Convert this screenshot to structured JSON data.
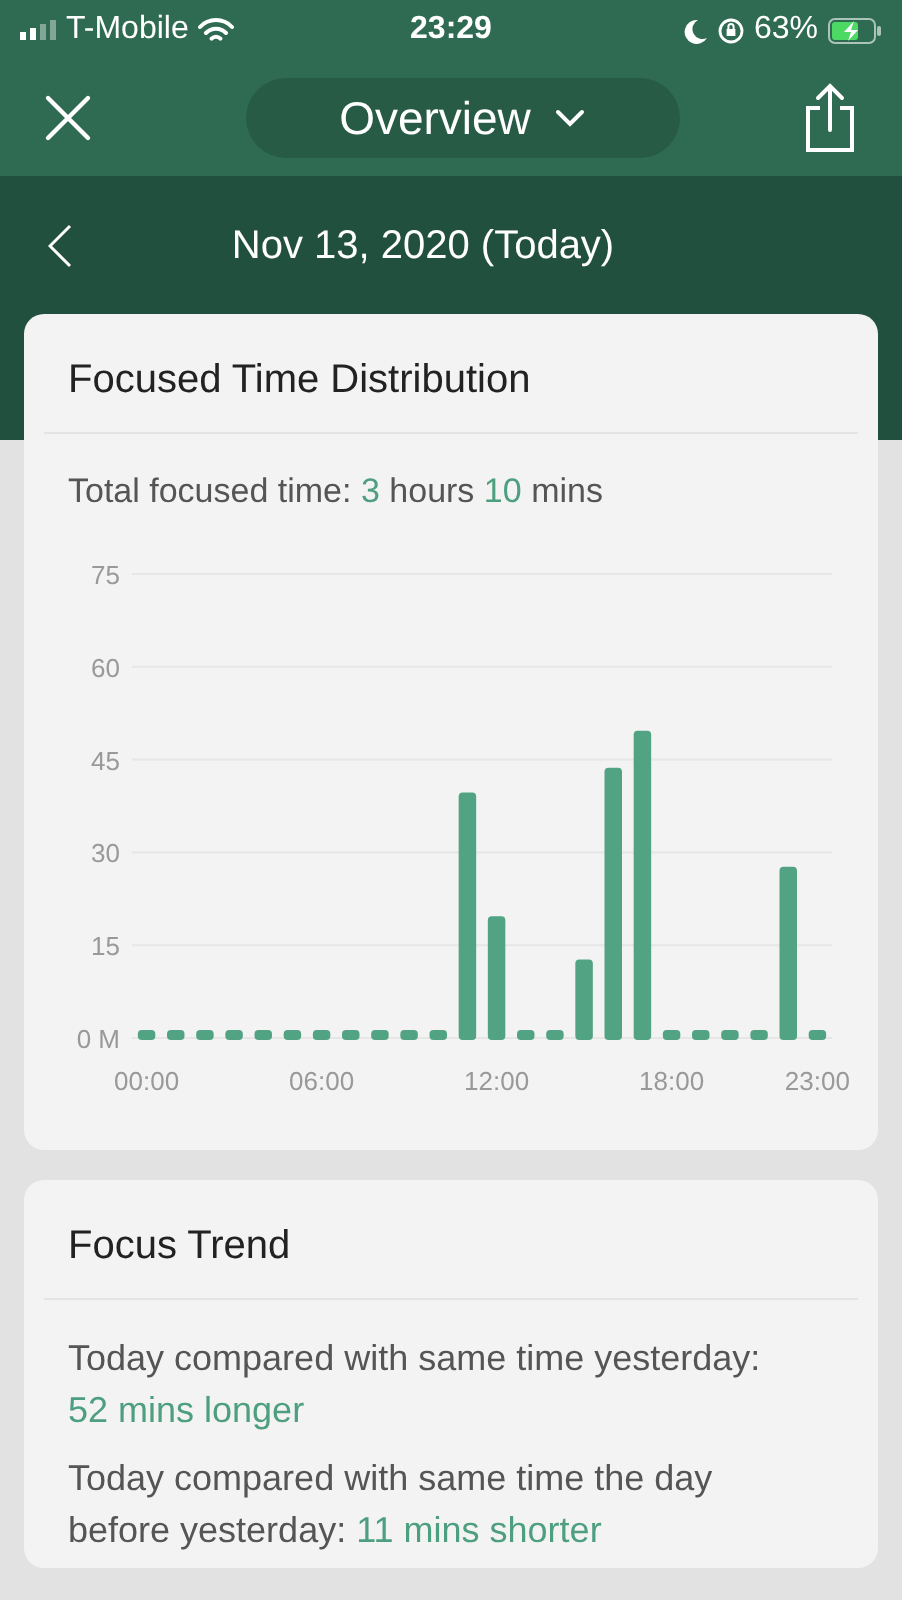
{
  "status_bar": {
    "carrier": "T-Mobile",
    "time": "23:29",
    "battery": "63%"
  },
  "nav": {
    "title": "Overview"
  },
  "date_bar": {
    "date": "Nov 13, 2020 (Today)"
  },
  "distribution": {
    "title": "Focused Time Distribution",
    "summary": [
      {
        "kind": "plain",
        "text": "Total focused time: "
      },
      {
        "kind": "value",
        "text": "3"
      },
      {
        "kind": "plain",
        "text": " hours "
      },
      {
        "kind": "value",
        "text": "10"
      },
      {
        "kind": "plain",
        "text": " mins"
      }
    ],
    "chart_data": {
      "type": "bar",
      "x": [
        0,
        1,
        2,
        3,
        4,
        5,
        6,
        7,
        8,
        9,
        10,
        11,
        12,
        13,
        14,
        15,
        16,
        17,
        18,
        19,
        20,
        21,
        22,
        23
      ],
      "series": [
        {
          "color": "#52a384",
          "values": [
            1,
            1,
            1,
            1,
            1,
            1,
            1,
            1,
            1,
            1,
            1,
            40,
            20,
            1,
            1,
            13,
            44,
            50,
            1,
            1,
            1,
            1,
            28,
            1
          ]
        }
      ],
      "xlim": [
        -0.5,
        23.5
      ],
      "ylim": [
        0,
        75
      ],
      "grid": true,
      "yticks": [
        {
          "value": 0,
          "label": "0 M"
        },
        15,
        30,
        45,
        60,
        75
      ],
      "xticks": [
        {
          "value": 0,
          "label": "00:00"
        },
        {
          "value": 6,
          "label": "06:00"
        },
        {
          "value": 12,
          "label": "12:00"
        },
        {
          "value": 18,
          "label": "18:00"
        },
        {
          "value": 23,
          "label": "23:00"
        }
      ]
    }
  },
  "trend": {
    "title": "Focus Trend",
    "lines": [
      [
        {
          "kind": "plain",
          "text": "Today compared with same time yesterday: "
        },
        {
          "kind": "value",
          "text": "52 mins longer"
        }
      ],
      [
        {
          "kind": "plain",
          "text": "Today compared with same time the day before yesterday: "
        },
        {
          "kind": "value",
          "text": "11 mins shorter"
        }
      ]
    ]
  }
}
